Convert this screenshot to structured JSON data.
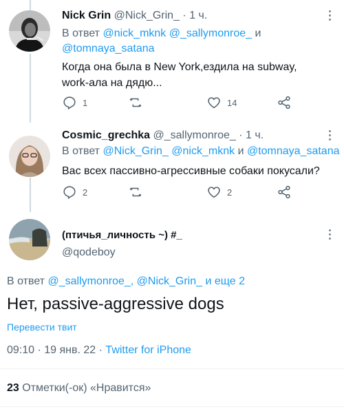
{
  "tweets": [
    {
      "name": "Nick Grin",
      "handle": "@Nick_Grin_",
      "time": "· 1 ч.",
      "reply_prefix": "В ответ",
      "reply_line1_mentions": "@nick_mknk @_sallymonroe_",
      "reply_and": "и",
      "reply_line2_mentions": "@tomnaya_satana",
      "text_line1": "Когда она была в New York,ездила на subway,",
      "text_line2": "work-ала на дядю...",
      "replies": "1",
      "retweets": "",
      "likes": "14",
      "avatar_icon": "avatar-bw-portrait"
    },
    {
      "name": "Cosmic_grechka",
      "handle": "@_sallymonroe_",
      "time": "· 1 ч.",
      "reply_prefix": "В ответ",
      "reply_mentions_a": "@Nick_Grin_ @nick_mknk",
      "reply_and": "и",
      "reply_mentions_b": "@tomnaya_satana",
      "text_line1": "Вас всех пассивно-агрессивные собаки покусали?",
      "replies": "2",
      "retweets": "",
      "likes": "2",
      "avatar_icon": "avatar-woman-glasses"
    }
  ],
  "main_tweet": {
    "name": "(птичья_личность ~) #_",
    "handle": "@qodeboy",
    "reply_prefix": "В ответ",
    "reply_mentions": "@_sallymonroe_, @Nick_Grin_",
    "reply_suffix": "и еще 2",
    "text": "Нет, passive-aggressive dogs",
    "translate_label": "Перевести твит",
    "time": "09:10 · 19 янв. 22 ·",
    "source": "Twitter for iPhone",
    "likes_count": "23",
    "likes_label": "Отметки(-ок) «Нравится»",
    "avatar_icon": "avatar-beach-landscape"
  },
  "colors": {
    "accent": "#1d9bf0",
    "secondary_text": "#536471",
    "primary_text": "#0f1419",
    "thread_line": "#cfd9de"
  }
}
